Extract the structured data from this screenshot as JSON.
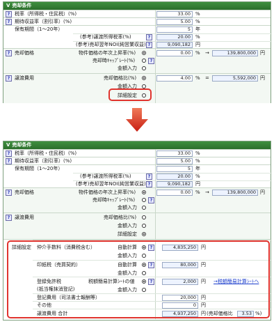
{
  "panel_title": "売却条件",
  "top": {
    "rows": {
      "tax_rate": {
        "label": "税率（所得税・住民税）(%)",
        "value": "33.00",
        "unit": "%"
      },
      "expected_return": {
        "label": "期待収益率（割引率）(%)",
        "value": "5.00",
        "unit": "%"
      },
      "holding_period": {
        "label": "保有期間（1〜20年）",
        "value": "5",
        "unit": "年"
      },
      "ref_transfer_tax": {
        "label": "(参考)譲渡所得税率(%)",
        "value": "20.00",
        "unit": "%"
      },
      "ref_noi": {
        "label": "(参考)売却翌年NOI(純営業収益)",
        "value": "9,090,182",
        "unit": "円"
      },
      "sale_price": {
        "label": "売却価格",
        "opt1": "物件価格の年次上昇率(%)",
        "opt2": "売却時ｷｬｯﾌﾟﾚｰﾄ(%)",
        "opt3": "金額入力",
        "value": "0.00",
        "unit": "%",
        "arrow": "→",
        "result": "139,800,000",
        "result_unit": "円"
      },
      "transfer_cost": {
        "label": "譲渡費用",
        "opt1": "売却価格比(%)",
        "opt2": "金額入力",
        "opt3": "詳細設定",
        "value": "4.00",
        "unit": "%",
        "eq": "=",
        "result": "5,592,000",
        "result_unit": "円"
      }
    }
  },
  "bottom": {
    "rows": {
      "tax_rate": {
        "label": "税率（所得税・住民税）(%)",
        "value": "33.00",
        "unit": "%"
      },
      "expected_return": {
        "label": "期待収益率（割引率）(%)",
        "value": "5.00",
        "unit": "%"
      },
      "holding_period": {
        "label": "保有期間（1〜20年）",
        "value": "5",
        "unit": "年"
      },
      "ref_transfer_tax": {
        "label": "(参考)譲渡所得税率(%)",
        "value": "20.00",
        "unit": "%"
      },
      "ref_noi": {
        "label": "(参考)売却翌年NOI(純営業収益)",
        "value": "9,090,182",
        "unit": "円"
      },
      "sale_price": {
        "label": "売却価格",
        "opt1": "物件価格の年次上昇率(%)",
        "opt2": "売却時ｷｬｯﾌﾟﾚｰﾄ(%)",
        "opt3": "金額入力",
        "value": "0.00",
        "unit": "%",
        "arrow": "→",
        "result": "139,800,000",
        "result_unit": "円"
      },
      "transfer_cost": {
        "label": "譲渡費用",
        "opt1": "売却価格比(%)",
        "opt2": "金額入力",
        "opt3": "詳細設定"
      }
    },
    "detail": {
      "label": "詳細設定",
      "brokerage": {
        "label": "仲介手数料（消費税含む）",
        "opt1": "自動計算",
        "opt2": "金額入力",
        "value": "4,835,250",
        "unit": "円"
      },
      "stamp": {
        "label": "印紙税（売買契約）",
        "opt1": "自動計算",
        "opt2": "金額入力",
        "value": "80,000",
        "unit": "円"
      },
      "registration": {
        "label": "登録免許税",
        "label2": "(抵当権抹消登記)",
        "opt1": "税額簡易計算ｼｰﾄの値",
        "opt2": "金額入力",
        "value": "2,000",
        "unit": "円",
        "link": "→税額簡易計算ｼｰﾄへ"
      },
      "registration_fee": {
        "label": "登記費用（司法書士報酬等）",
        "value": "20,000",
        "unit": "円"
      },
      "other": {
        "label": "その他",
        "value": "0",
        "unit": "円"
      },
      "total": {
        "label": "譲渡費用 合計",
        "value": "4,937,250",
        "unit": "円",
        "ratio_label": "(売却価格比",
        "ratio": "3.53",
        "ratio_unit": "%)"
      }
    }
  },
  "help_glyph": "?",
  "icons": {
    "chevron": "chevron-down-icon",
    "help": "help-icon",
    "arrow": "down-arrow-icon"
  },
  "colors": {
    "title_bar": "#2c6e2c",
    "highlight": "#e0342e",
    "arrow": "#e0342e",
    "link": "#1a3ccc"
  }
}
